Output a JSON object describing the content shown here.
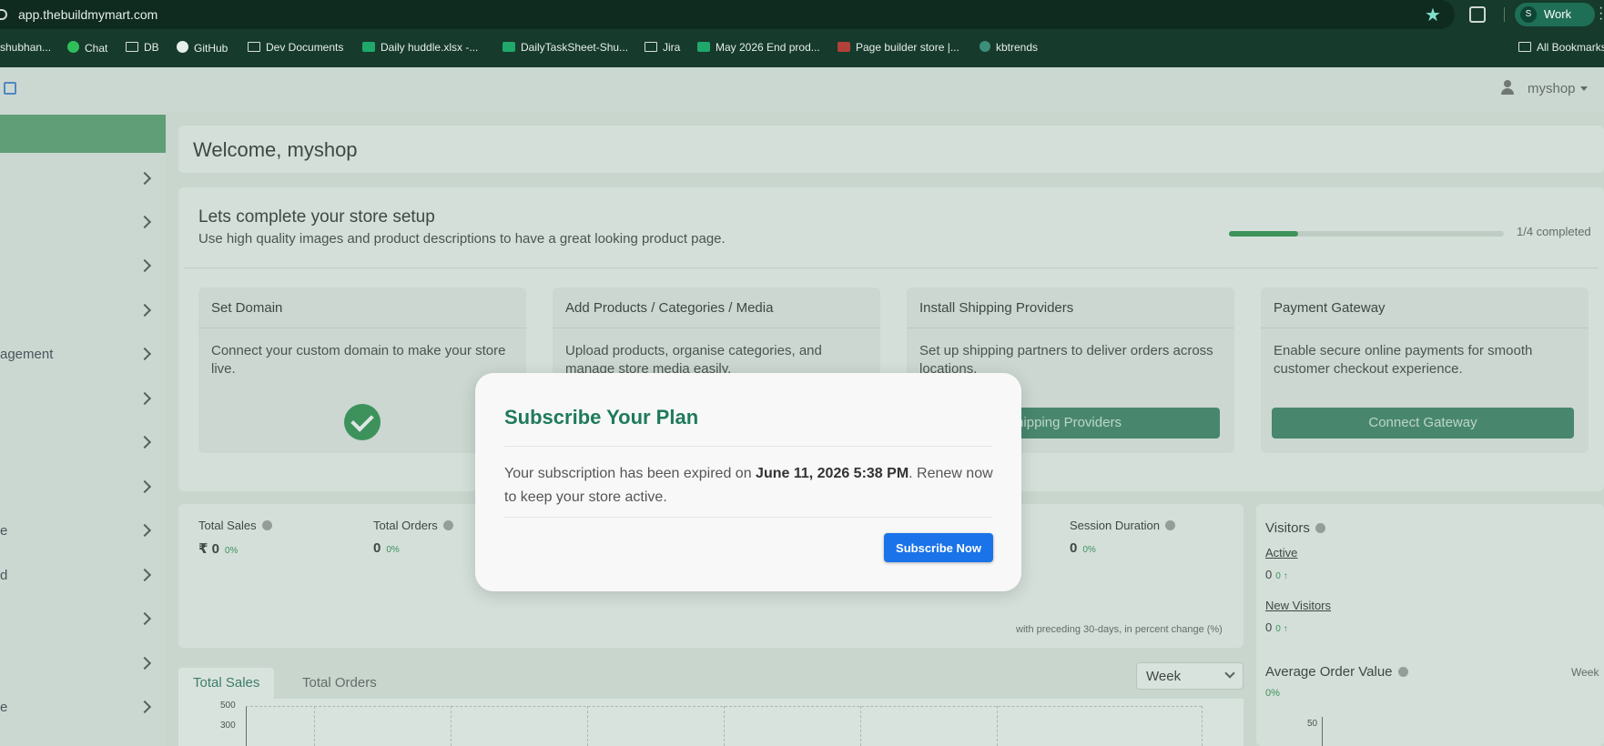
{
  "browser": {
    "url": "app.thebuildmymart.com",
    "profile_initial": "S",
    "profile_label": "Work",
    "bookmarks": [
      "shubhan...",
      "Chat",
      "DB",
      "GitHub",
      "Dev Documents",
      "Daily huddle.xlsx -...",
      "DailyTaskSheet-Shu...",
      "Jira",
      "May 2026 End prod...",
      "Page builder store |...",
      "kbtrends",
      "All Bookmarks"
    ]
  },
  "header": {
    "user_name": "myshop"
  },
  "sidebar": {
    "items": [
      "",
      "",
      "",
      "",
      "agement",
      "",
      "",
      "",
      "e",
      "d",
      "",
      "",
      "e"
    ]
  },
  "welcome": {
    "title": "Welcome, myshop"
  },
  "setup": {
    "title": "Lets complete your store setup",
    "subtitle": "Use high quality images and product descriptions to have a great looking product page.",
    "progress_text": "1/4 completed",
    "progress_fraction": 0.25,
    "steps": [
      {
        "title": "Set Domain",
        "desc": "Connect your custom domain to make your store live.",
        "button": ""
      },
      {
        "title": "Add Products / Categories / Media",
        "desc": "Upload products, organise categories, and manage store media easily.",
        "button": ""
      },
      {
        "title": "Install Shipping Providers",
        "desc": "Set up shipping partners to deliver orders across locations.",
        "button": "hipping Providers"
      },
      {
        "title": "Payment Gateway",
        "desc": "Enable secure online payments for smooth customer checkout experience.",
        "button": "Connect Gateway"
      }
    ]
  },
  "stats": {
    "items": [
      {
        "label": "Total Sales",
        "value": "₹ 0",
        "pct": "0%"
      },
      {
        "label": "Total Orders",
        "value": "0",
        "pct": "0%"
      },
      {
        "label": "Session Duration",
        "value": "0",
        "pct": "0%"
      }
    ],
    "note": "with preceding 30-days, in percent change (%)"
  },
  "chart_tabs": {
    "active": "Total Sales",
    "inactive": "Total Orders",
    "period": "Week"
  },
  "chart_data": {
    "type": "line",
    "y_ticks": [
      "500",
      "300"
    ]
  },
  "visitors": {
    "title": "Visitors",
    "active_label": "Active",
    "active_value": "0",
    "active_change": "0 ↑",
    "new_label": "New Visitors",
    "new_value": "0",
    "new_change": "0 ↑"
  },
  "aov": {
    "title": "Average Order Value",
    "period": "Week",
    "pct": "0%",
    "tick": "50"
  },
  "modal": {
    "title": "Subscribe Your Plan",
    "body_prefix": "Your subscription has been expired on ",
    "body_date": "June 11, 2026 5:38 PM",
    "body_suffix": ". Renew now to keep your store active.",
    "button": "Subscribe Now"
  }
}
